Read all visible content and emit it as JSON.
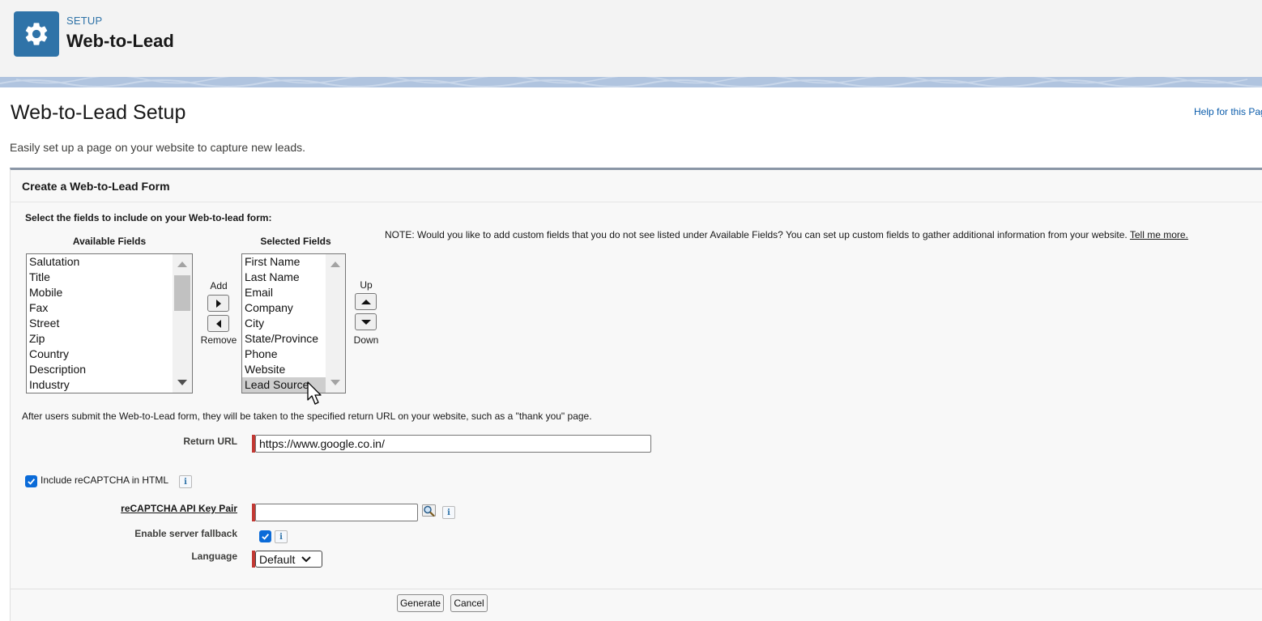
{
  "header": {
    "kicker": "SETUP",
    "title": "Web-to-Lead",
    "icon": "gear-icon",
    "icon_color": "#2f73a8"
  },
  "page": {
    "title": "Web-to-Lead Setup",
    "help_link": "Help for this Page",
    "subtitle": "Easily set up a page on your website to capture new leads."
  },
  "form": {
    "section_title": "Create a Web-to-Lead Form",
    "select_label": "Select the fields to include on your Web-to-lead form:",
    "available_header": "Available Fields",
    "selected_header": "Selected Fields",
    "available_fields": [
      "Salutation",
      "Title",
      "Mobile",
      "Fax",
      "Street",
      "Zip",
      "Country",
      "Description",
      "Industry"
    ],
    "selected_fields": [
      "First Name",
      "Last Name",
      "Email",
      "Company",
      "City",
      "State/Province",
      "Phone",
      "Website",
      "Lead Source"
    ],
    "highlighted_selected": "Lead Source",
    "add_label": "Add",
    "remove_label": "Remove",
    "up_label": "Up",
    "down_label": "Down",
    "note_text": "NOTE: Would you like to add custom fields that you do not see listed under Available Fields? You can set up custom fields to gather additional information from your website.",
    "note_link": "Tell me more.",
    "after_text": "After users submit the Web-to-Lead form, they will be taken to the specified return URL on your website, such as a \"thank you\" page.",
    "return_url_label": "Return URL",
    "return_url_value": "https://www.google.co.in/",
    "recaptcha_label": "Include reCAPTCHA in HTML",
    "recaptcha_checked": true,
    "api_key_label": "reCAPTCHA API Key Pair",
    "api_key_value": "",
    "fallback_label": "Enable server fallback",
    "fallback_checked": true,
    "language_label": "Language",
    "language_value": "Default",
    "generate_label": "Generate",
    "cancel_label": "Cancel"
  },
  "colors": {
    "accent": "#2f73a8",
    "link": "#0b5cab",
    "checkbox": "#0b6bd8",
    "required": "#c23934"
  }
}
